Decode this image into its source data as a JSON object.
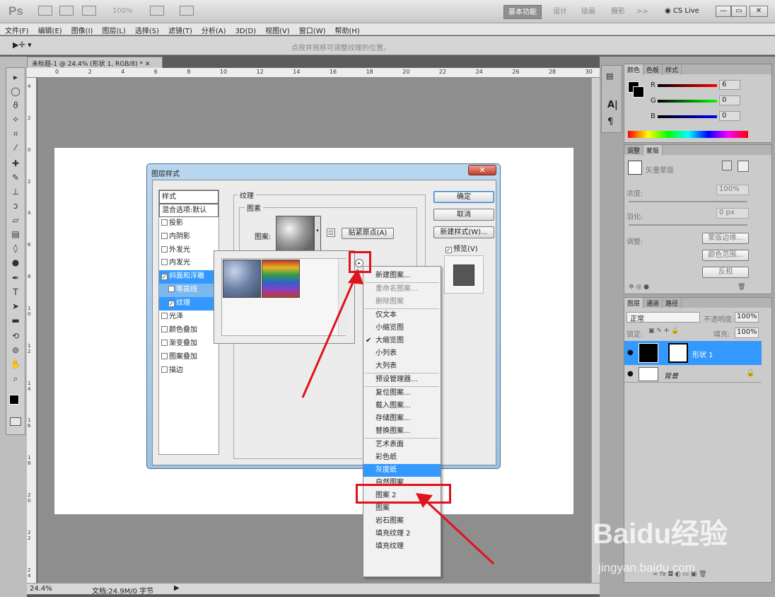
{
  "app": {
    "logo": "Ps",
    "zoom": "100%"
  },
  "workspaces": [
    "基本功能",
    "设计",
    "绘画",
    "摄影",
    ">>"
  ],
  "cslive": "CS Live",
  "window_buttons": [
    "—",
    "▭",
    "✕"
  ],
  "menu": [
    "文件(F)",
    "编辑(E)",
    "图像(I)",
    "图层(L)",
    "选择(S)",
    "滤镜(T)",
    "分析(A)",
    "3D(D)",
    "视图(V)",
    "窗口(W)",
    "帮助(H)"
  ],
  "options": {
    "hint": "点按并拖移可调整纹理的位置。"
  },
  "document": {
    "tab": "未标题-1 @ 24.4% (形状 1, RGB/8) *",
    "close": "✕"
  },
  "ruler_h": [
    "0",
    "2",
    "4",
    "6",
    "8",
    "10",
    "12",
    "14",
    "16",
    "18",
    "20",
    "22",
    "24",
    "26",
    "28",
    "30"
  ],
  "ruler_v": [
    "4",
    "2",
    "0",
    "2",
    "4",
    "6",
    "8",
    "1 0",
    "1 2",
    "1 4",
    "1 6",
    "1 8",
    "2 0",
    "2 2",
    "2 4"
  ],
  "status": {
    "zoom": "24.4%",
    "doc": "文档:24.9M/0 字节"
  },
  "color_panel": {
    "tabs": [
      "颜色",
      "色板",
      "样式"
    ],
    "channels": [
      {
        "label": "R",
        "value": "6"
      },
      {
        "label": "G",
        "value": "0"
      },
      {
        "label": "B",
        "value": "0"
      }
    ]
  },
  "adjust_panel": {
    "tabs": [
      "调整",
      "蒙版"
    ],
    "mask_label": "矢量蒙版",
    "density_label": "浓度:",
    "density": "100%",
    "feather_label": "羽化:",
    "feather": "0 px",
    "refine_label": "调整:",
    "buttons": [
      "蒙版边缘...",
      "颜色范围...",
      "反相"
    ]
  },
  "layers_panel": {
    "tabs": [
      "图层",
      "通道",
      "路径"
    ],
    "blend": "正常",
    "opacity_label": "不透明度:",
    "opacity": "100%",
    "lock_label": "锁定:",
    "fill_label": "填充:",
    "fill": "100%",
    "layers": [
      {
        "name": "形状 1"
      },
      {
        "name": "背景"
      }
    ]
  },
  "dialog": {
    "title": "图层样式",
    "close": "✕",
    "styles": [
      "样式",
      "混合选项:默认",
      "投影",
      "内阴影",
      "外发光",
      "内发光",
      "斜面和浮雕",
      "等高线",
      "纹理",
      "光泽",
      "颜色叠加",
      "渐变叠加",
      "图案叠加",
      "描边"
    ],
    "texture_group": "纹理",
    "pattern_group": "图素",
    "pattern_label": "图案:",
    "snap_button": "贴紧原点(A)",
    "ok": "确定",
    "cancel": "取消",
    "new_style": "新建样式(W)...",
    "preview": "预览(V)"
  },
  "flyout_menu": [
    {
      "label": "新建图案...",
      "state": "normal"
    },
    {
      "label": "重命名图案...",
      "state": "disabled"
    },
    {
      "label": "删除图案",
      "state": "disabled"
    },
    {
      "label": "仅文本",
      "state": "normal"
    },
    {
      "label": "小缩览图",
      "state": "normal"
    },
    {
      "label": "大缩览图",
      "state": "checked"
    },
    {
      "label": "小列表",
      "state": "normal"
    },
    {
      "label": "大列表",
      "state": "normal"
    },
    {
      "label": "预设管理器...",
      "state": "normal"
    },
    {
      "label": "复位图案...",
      "state": "normal"
    },
    {
      "label": "载入图案...",
      "state": "normal"
    },
    {
      "label": "存储图案...",
      "state": "normal"
    },
    {
      "label": "替换图案...",
      "state": "normal"
    },
    {
      "label": "艺术表面",
      "state": "normal"
    },
    {
      "label": "彩色纸",
      "state": "normal"
    },
    {
      "label": "灰度纸",
      "state": "highlighted"
    },
    {
      "label": "自然图案",
      "state": "normal"
    },
    {
      "label": "图案 2",
      "state": "normal"
    },
    {
      "label": "图案",
      "state": "normal"
    },
    {
      "label": "岩石图案",
      "state": "normal"
    },
    {
      "label": "填充纹理 2",
      "state": "normal"
    },
    {
      "label": "填充纹理",
      "state": "normal"
    }
  ],
  "watermark": {
    "brand": "Baidu经验",
    "url": "jingyan.baidu.com"
  },
  "colors": {
    "highlight": "#3399ff",
    "annotation_red": "#e0121b",
    "dialog_frame": "#9dc3e4"
  },
  "icons": [
    "move-icon",
    "marquee-icon",
    "lasso-icon",
    "magic-wand-icon",
    "crop-icon",
    "eyedropper-icon",
    "healing-icon",
    "brush-icon",
    "stamp-icon",
    "history-brush-icon",
    "eraser-icon",
    "gradient-icon",
    "blur-icon",
    "dodge-icon",
    "pen-icon",
    "type-icon",
    "path-select-icon",
    "shape-icon",
    "3d-rotate-icon",
    "3d-orbit-icon",
    "hand-icon",
    "zoom-icon"
  ]
}
